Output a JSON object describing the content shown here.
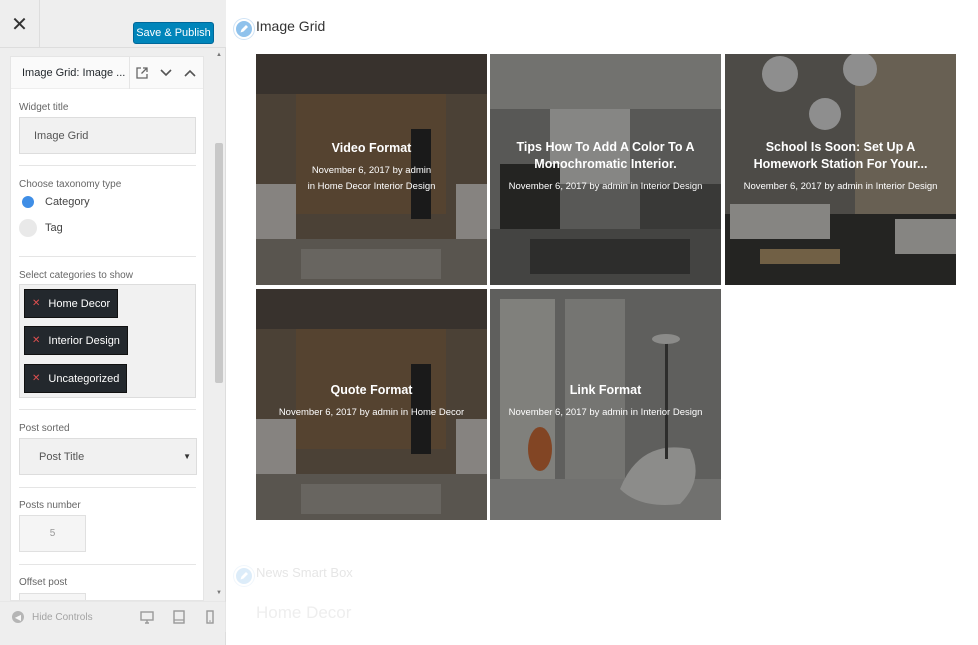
{
  "panel": {
    "close_label": "✕",
    "publish_label": "Save & Publish",
    "widget_title": "Image Grid: Image ...",
    "fields": {
      "widget_title_label": "Widget title",
      "widget_title_value": "Image Grid",
      "taxonomy_label": "Choose taxonomy type",
      "taxonomy_options": [
        "Category",
        "Tag"
      ],
      "taxonomy_selected": "Category",
      "categories_label": "Select categories to show",
      "categories": [
        "Home Decor",
        "Interior Design",
        "Uncategorized"
      ],
      "sorted_label": "Post sorted",
      "sorted_value": "Post Title",
      "posts_number_label": "Posts number",
      "posts_number_value": "5",
      "offset_label": "Offset post"
    },
    "footer": {
      "hide_controls": "Hide Controls"
    },
    "icons": [
      "close-icon",
      "external-link-icon",
      "chevron-down-icon",
      "chevron-up-icon",
      "arrow-left-icon",
      "desktop-icon",
      "tablet-icon",
      "mobile-icon"
    ]
  },
  "preview": {
    "section_title": "Image Grid",
    "cards": [
      {
        "title": "Video Format",
        "date": "November 6, 2017",
        "author": "admin",
        "categories": "Home Decor Interior Design"
      },
      {
        "title": "Tips How To Add A Color To A Monochromatic Interior.",
        "date": "November 6, 2017",
        "author": "admin",
        "categories": "Interior Design"
      },
      {
        "title": "School Is Soon: Set Up A Homework Station For Your...",
        "date": "November 6, 2017",
        "author": "admin",
        "categories": "Interior Design"
      },
      {
        "title": "Quote Format",
        "date": "November 6, 2017",
        "author": "admin",
        "categories": "Home Decor"
      },
      {
        "title": "Link Format",
        "date": "November 6, 2017",
        "author": "admin",
        "categories": "Interior Design"
      }
    ],
    "faded_section_title": "News Smart Box",
    "faded_subtitle": "Home Decor"
  },
  "colors": {
    "publish": "#0085ba",
    "radio": "#3f8ee6",
    "chip": "#23282d",
    "pencil": "#8fc2ec"
  }
}
